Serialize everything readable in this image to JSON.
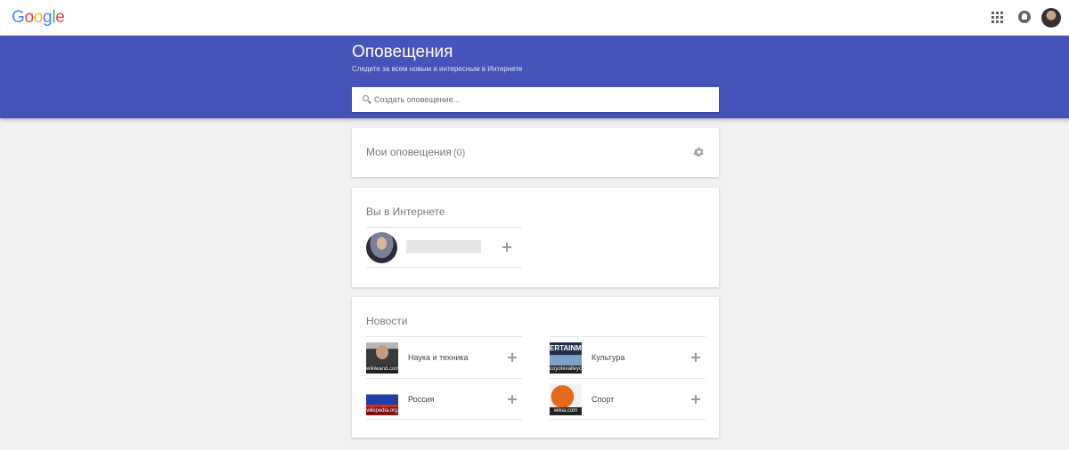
{
  "header": {
    "logo_letters": [
      "G",
      "o",
      "o",
      "g",
      "l",
      "e"
    ],
    "logo_colors": [
      "#4285F4",
      "#EA4335",
      "#FBBC05",
      "#4285F4",
      "#34A853",
      "#EA4335"
    ],
    "icons": [
      "apps-grid-icon",
      "notifications-icon",
      "account-avatar"
    ]
  },
  "banner": {
    "title": "Оповещения",
    "subtitle": "Следите за всем новым и интересным в Интернете",
    "search_placeholder": "Создать оповещение...",
    "color": "#4653b8"
  },
  "my_alerts": {
    "title": "Мои оповещения",
    "count": "(0)"
  },
  "web": {
    "title": "Вы в Интернете"
  },
  "news": {
    "title": "Новости",
    "items": [
      {
        "label": "Наука и техника",
        "thumb_caption": "wikiwand.com"
      },
      {
        "label": "Культура",
        "thumb_caption": "coyotevalleyca",
        "thumb_text": "ERTAINM"
      },
      {
        "label": "Россия",
        "thumb_caption": "wikipedia.org"
      },
      {
        "label": "Спорт",
        "thumb_caption": "wikia.com"
      }
    ]
  }
}
